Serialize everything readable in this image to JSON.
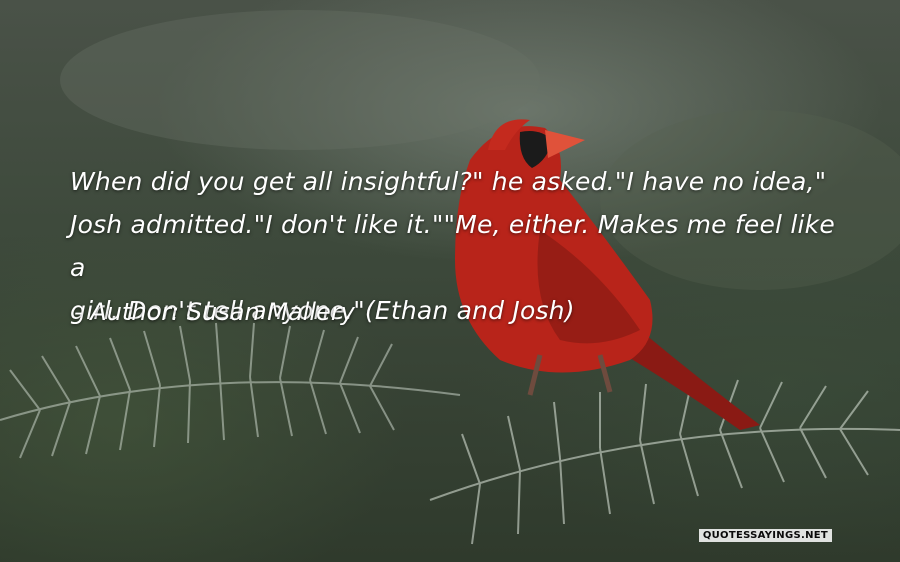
{
  "quote": {
    "line1": "When did you get all insightful?\" he asked.\"I have no idea,\"",
    "line2": "Josh admitted.\"I don't like it.\"\"Me, either. Makes me feel like a",
    "line3": "girl. Don't tell anyone.\"(Ethan and Josh)"
  },
  "author_line": "- Author: Susan Mallery",
  "watermark": "QUOTESSAYINGS.NET",
  "scene": {
    "subject": "red-cardinal-icon",
    "background": "pine-branches"
  },
  "colors": {
    "text": "#ffffff",
    "bird_red": "#b8241a"
  }
}
